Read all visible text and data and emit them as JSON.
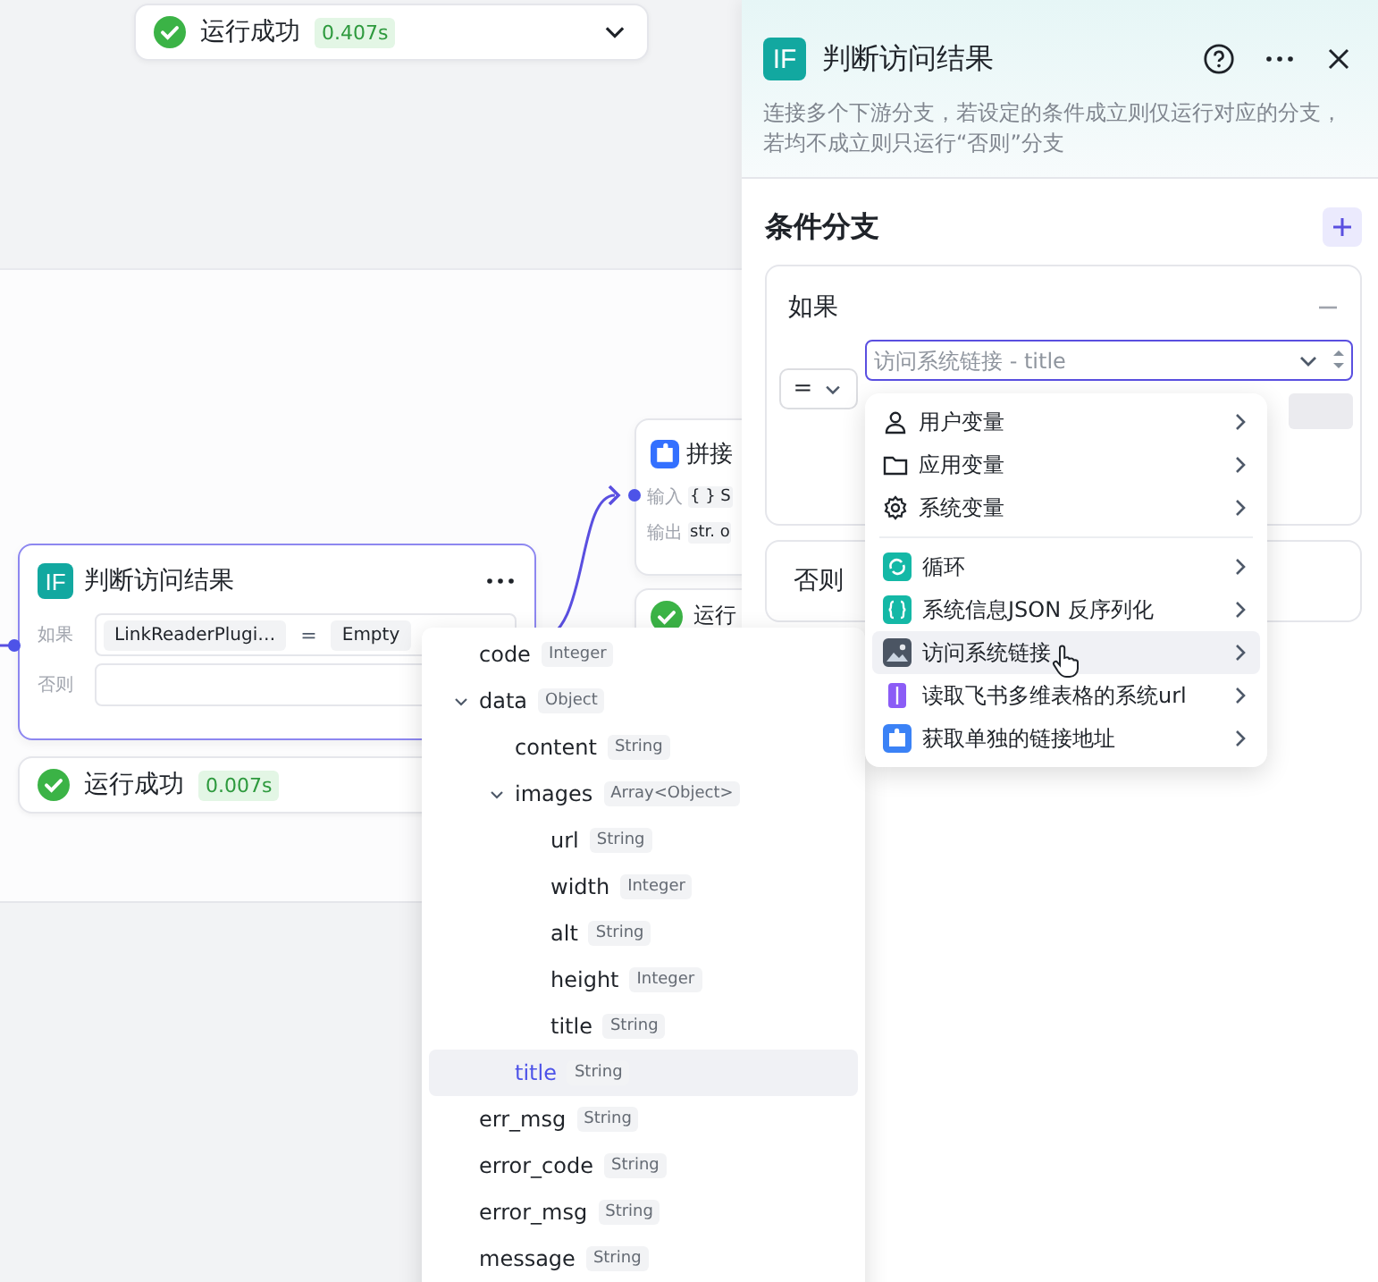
{
  "canvas": {
    "top_status": {
      "text": "运行成功",
      "time": "0.407s"
    },
    "if_node": {
      "icon": "IF",
      "title": "判断访问结果",
      "if_label": "如果",
      "condition": {
        "left": "LinkReaderPlugi…",
        "operator": "=",
        "right": "Empty"
      },
      "else_label": "否则",
      "selected": true
    },
    "if_status": {
      "text": "运行成功",
      "time": "0.007s"
    },
    "concat_node": {
      "title": "拼接",
      "rows": [
        {
          "label": "输入",
          "value": "{ } S"
        },
        {
          "label": "输出",
          "value": "str. o"
        }
      ]
    },
    "concat_status": {
      "text": "运行"
    }
  },
  "panel": {
    "icon": "IF",
    "title": "判断访问结果",
    "description": "连接多个下游分支，若设定的条件成立则仅运行对应的分支，若均不成立则只运行“否则”分支",
    "section_title": "条件分支",
    "if_label": "如果",
    "operator": "=",
    "variable": {
      "placeholder": "访问系统链接 - title"
    },
    "else_label": "否则"
  },
  "variable_menu": {
    "groups": [
      {
        "kind": "person",
        "label": "用户变量",
        "selected": false
      },
      {
        "kind": "folder",
        "label": "应用变量",
        "selected": false
      },
      {
        "kind": "gear",
        "label": "系统变量",
        "selected": false
      }
    ],
    "nodes": [
      {
        "kind": "loop",
        "label": "循环",
        "color": "#14b8a6",
        "selected": false
      },
      {
        "kind": "braces",
        "label": "系统信息JSON 反序列化",
        "color": "#14b8a6",
        "selected": false
      },
      {
        "kind": "image",
        "label": "访问系统链接",
        "color": "#4b5563",
        "selected": true
      },
      {
        "kind": "book",
        "label": "读取飞书多维表格的系统url",
        "color": "#8b5cf6",
        "selected": false
      },
      {
        "kind": "puzzle",
        "label": "获取单独的链接地址",
        "color": "#3b82f6",
        "selected": false
      }
    ]
  },
  "output_tree": [
    {
      "name": "code",
      "type": "Integer",
      "selected": false
    },
    {
      "name": "data",
      "type": "Object",
      "selected": false,
      "expanded": true,
      "children": [
        {
          "name": "content",
          "type": "String",
          "selected": false
        },
        {
          "name": "images",
          "type": "Array<Object>",
          "selected": false,
          "expanded": true,
          "children": [
            {
              "name": "url",
              "type": "String",
              "selected": false
            },
            {
              "name": "width",
              "type": "Integer",
              "selected": false
            },
            {
              "name": "alt",
              "type": "String",
              "selected": false
            },
            {
              "name": "height",
              "type": "Integer",
              "selected": false
            },
            {
              "name": "title",
              "type": "String",
              "selected": false
            }
          ]
        },
        {
          "name": "title",
          "type": "String",
          "selected": true
        }
      ]
    },
    {
      "name": "err_msg",
      "type": "String",
      "selected": false
    },
    {
      "name": "error_code",
      "type": "String",
      "selected": false
    },
    {
      "name": "error_msg",
      "type": "String",
      "selected": false
    },
    {
      "name": "message",
      "type": "String",
      "selected": false
    }
  ]
}
